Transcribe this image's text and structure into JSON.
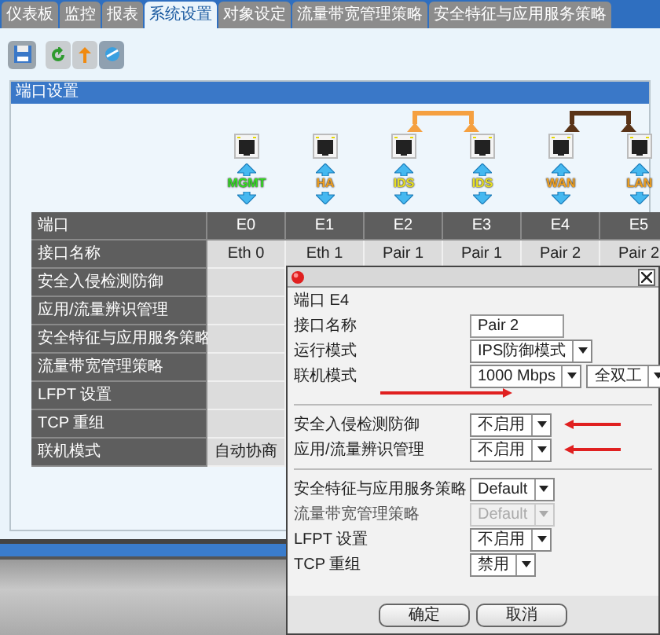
{
  "tabs": [
    {
      "label": "仪表板",
      "selected": false
    },
    {
      "label": "监控",
      "selected": false
    },
    {
      "label": "报表",
      "selected": false
    },
    {
      "label": "系统设置",
      "selected": true
    },
    {
      "label": "对象设定",
      "selected": false
    },
    {
      "label": "流量带宽管理策略",
      "selected": false
    },
    {
      "label": "安全特征与应用服务策略",
      "selected": false
    }
  ],
  "panel": {
    "title": "端口设置",
    "ports": [
      {
        "label": "MGMT",
        "color": "#33dd22",
        "linked": false
      },
      {
        "label": "HA",
        "color": "#f0a020",
        "linked": false
      },
      {
        "label": "IDS",
        "color": "#e8e020",
        "linked": true
      },
      {
        "label": "IDS",
        "color": "#e8e020",
        "linked": true
      },
      {
        "label": "WAN",
        "color": "#f0a020",
        "linked": true
      },
      {
        "label": "LAN",
        "color": "#f0a020",
        "linked": true
      }
    ],
    "links": [
      {
        "color": "#f5a040"
      },
      {
        "color": "#5a3418"
      }
    ],
    "table": {
      "columns": [
        "端口",
        "E0",
        "E1",
        "E2",
        "E3",
        "E4",
        "E5"
      ],
      "rows": [
        {
          "cells": [
            "接口名称",
            "Eth 0",
            "Eth 1",
            "Pair 1",
            "Pair 1",
            "Pair 2",
            "Pair 2"
          ]
        },
        {
          "cells": [
            "安全入侵检测防御"
          ]
        },
        {
          "cells": [
            "应用/流量辨识管理"
          ]
        },
        {
          "cells": [
            "安全特征与应用服务策略"
          ]
        },
        {
          "cells": [
            "流量带宽管理策略"
          ]
        },
        {
          "cells": [
            "LFPT 设置"
          ]
        },
        {
          "cells": [
            "TCP 重组"
          ]
        },
        {
          "cells": [
            "联机模式",
            "自动协商"
          ]
        }
      ]
    }
  },
  "dialog": {
    "heading": "端口 E4",
    "sections": [
      [
        {
          "kind": "text",
          "label": "接口名称",
          "values": [
            "Pair 2"
          ],
          "arrow_below": false,
          "arrow_beside": false
        },
        {
          "kind": "select",
          "label": "运行模式",
          "values": [
            "IPS防御模式"
          ],
          "disabled": false,
          "arrow_below": false,
          "arrow_beside": false
        },
        {
          "kind": "select",
          "label": "联机模式",
          "values": [
            "1000 Mbps",
            "全双工"
          ],
          "disabled": false,
          "arrow_below": true,
          "arrow_beside": false
        }
      ],
      [
        {
          "kind": "select",
          "label": "安全入侵检测防御",
          "values": [
            "不启用"
          ],
          "disabled": false,
          "arrow_below": false,
          "arrow_beside": true
        },
        {
          "kind": "select",
          "label": "应用/流量辨识管理",
          "values": [
            "不启用"
          ],
          "disabled": false,
          "arrow_below": false,
          "arrow_beside": true
        }
      ],
      [
        {
          "kind": "select",
          "label": "安全特征与应用服务策略",
          "values": [
            "Default"
          ],
          "disabled": false,
          "arrow_below": false,
          "arrow_beside": false
        },
        {
          "kind": "select",
          "label": "流量带宽管理策略",
          "values": [
            "Default"
          ],
          "disabled": true,
          "arrow_below": false,
          "arrow_beside": false
        },
        {
          "kind": "select",
          "label": "LFPT 设置",
          "values": [
            "不启用"
          ],
          "disabled": false,
          "arrow_below": false,
          "arrow_beside": false
        },
        {
          "kind": "select",
          "label": "TCP 重组",
          "values": [
            "禁用"
          ],
          "disabled": false,
          "arrow_below": false,
          "arrow_beside": false
        }
      ]
    ],
    "buttons": [
      "确定",
      "取消"
    ]
  }
}
